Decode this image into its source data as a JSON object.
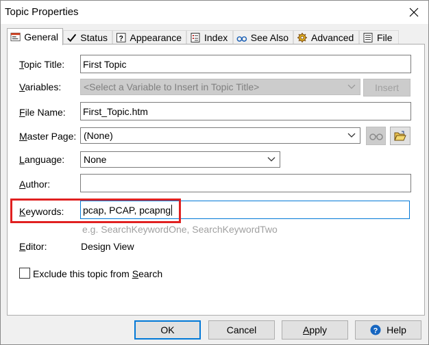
{
  "window": {
    "title": "Topic Properties"
  },
  "tabs": [
    {
      "label": "General",
      "icon": "general-icon"
    },
    {
      "label": "Status",
      "icon": "checkmark-icon"
    },
    {
      "label": "Appearance",
      "icon": "question-icon"
    },
    {
      "label": "Index",
      "icon": "index-icon"
    },
    {
      "label": "See Also",
      "icon": "glasses-icon"
    },
    {
      "label": "Advanced",
      "icon": "gear-icon"
    },
    {
      "label": "File",
      "icon": "file-icon"
    }
  ],
  "fields": {
    "topic_title": {
      "label_first": "T",
      "label_rest": "opic Title:",
      "value": "First Topic"
    },
    "variables": {
      "label_first": "V",
      "label_rest": "ariables:",
      "value": "<Select a Variable to Insert in Topic Title>",
      "button": "Insert"
    },
    "file_name": {
      "label_first": "F",
      "label_rest": "ile Name:",
      "value": "First_Topic.htm"
    },
    "master_page": {
      "label_first": "M",
      "label_rest": "aster Page:",
      "value": "(None)"
    },
    "language": {
      "label_first": "L",
      "label_rest": "anguage:",
      "value": "None"
    },
    "author": {
      "label_first": "A",
      "label_rest": "uthor:",
      "value": ""
    },
    "keywords": {
      "label_first": "K",
      "label_rest": "eywords:",
      "value": "pcap, PCAP, pcapng",
      "hint": "e.g. SearchKeywordOne, SearchKeywordTwo"
    },
    "editor": {
      "label_first": "E",
      "label_rest": "ditor:",
      "value": "Design View"
    }
  },
  "exclude": {
    "label_pre": "Exclude this topic from ",
    "label_u": "S",
    "label_post": "earch",
    "checked": false
  },
  "buttons": {
    "ok": "OK",
    "cancel": "Cancel",
    "apply_u": "A",
    "apply_rest": "pply",
    "help": "Help"
  },
  "colors": {
    "accent": "#0078d7",
    "highlight": "#e02020"
  }
}
